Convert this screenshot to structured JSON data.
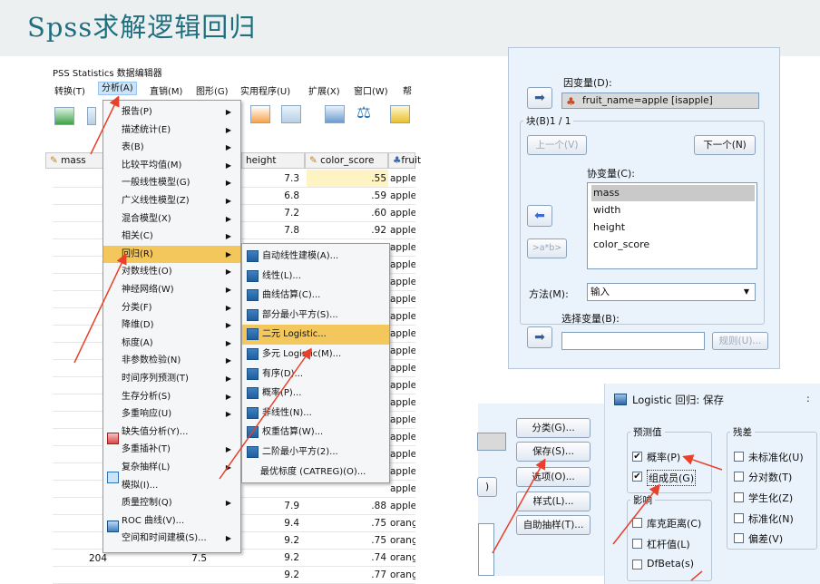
{
  "page_title": "Spss求解逻辑回归",
  "spss": {
    "window_title": "PSS Statistics 数据编辑器",
    "menubar": [
      "转换(T)",
      "分析(A)",
      "直销(M)",
      "图形(G)",
      "实用程序(U)",
      "扩展(X)",
      "窗口(W)",
      "帮"
    ],
    "columns": [
      "mass",
      "height",
      "color_score",
      "fruit"
    ],
    "analyze_menu": [
      "报告(P)",
      "描述统计(E)",
      "表(B)",
      "比较平均值(M)",
      "一般线性模型(G)",
      "广义线性模型(Z)",
      "混合模型(X)",
      "相关(C)",
      "回归(R)",
      "对数线性(O)",
      "神经网络(W)",
      "分类(F)",
      "降维(D)",
      "标度(A)",
      "非参数检验(N)",
      "时间序列预测(T)",
      "生存分析(S)",
      "多重响应(U)",
      "缺失值分析(Y)...",
      "多重插补(T)",
      "复杂抽样(L)",
      "模拟(I)...",
      "质量控制(Q)",
      "ROC 曲线(V)...",
      "空间和时间建模(S)..."
    ],
    "regression_submenu": [
      "自动线性建模(A)...",
      "线性(L)...",
      "曲线估算(C)...",
      "部分最小平方(S)...",
      "二元 Logistic...",
      "多元 Logistic(M)...",
      "有序(D)...",
      "概率(P)...",
      "非线性(N)...",
      "权重估算(W)...",
      "二阶最小平方(2)...",
      "最优标度 (CATREG)(O)..."
    ],
    "height_values": [
      "7.3",
      "6.8",
      "7.2",
      "7.8",
      "",
      "",
      "",
      "",
      "",
      "",
      "",
      "",
      "",
      "",
      "",
      "",
      "",
      "",
      "",
      "7.9",
      "9.4",
      "9.2",
      "9.2",
      "9.2"
    ],
    "color_values": [
      ".55",
      ".59",
      ".60",
      ".92",
      "",
      "",
      "",
      "",
      "",
      "",
      "",
      "",
      "",
      "",
      "",
      "",
      "",
      "",
      "",
      ".88",
      ".75",
      ".75",
      ".74",
      ".77"
    ],
    "fruit_values": [
      "apple",
      "apple",
      "apple",
      "apple",
      "apple",
      "apple",
      "apple",
      "apple",
      "apple",
      "apple",
      "apple",
      "apple",
      "apple",
      "apple",
      "apple",
      "apple",
      "apple",
      "apple",
      "apple",
      "apple",
      "orang",
      "orang",
      "orang",
      "orang"
    ],
    "row_number": "204",
    "row_value": "7.5"
  },
  "logistic_dialog": {
    "dependent_label": "因变量(D):",
    "dependent_value": "fruit_name=apple [isapple]",
    "block_label": "块(B)1 / 1",
    "prev_button": "上一个(V)",
    "next_button": "下一个(N)",
    "covariates_label": "协变量(C):",
    "covariates": [
      "mass",
      "width",
      "height",
      "color_score"
    ],
    "interaction_button": ">a*b>",
    "method_label": "方法(M):",
    "method_value": "输入",
    "select_var_label": "选择变量(B):",
    "rule_button": "规则(U)..."
  },
  "buttons_panel": {
    "buttons": [
      "分类(G)...",
      "保存(S)...",
      "选项(O)...",
      "样式(L)...",
      "自助抽样(T)..."
    ],
    "partial_button": ")"
  },
  "save_dialog": {
    "title": "Logistic 回归: 保存",
    "predicted_group": "预测值",
    "predicted_items": [
      {
        "label": "概率(P)",
        "checked": true
      },
      {
        "label": "组成员(G)",
        "checked": true
      }
    ],
    "influence_group": "影响",
    "influence_items": [
      "库克距离(C)",
      "杠杆值(L)",
      "DfBeta(s)"
    ],
    "residuals_group": "残差",
    "residual_items": [
      "未标准化(U)",
      "分对数(T)",
      "学生化(Z)",
      "标准化(N)",
      "偏差(V)"
    ]
  },
  "colors": {
    "title": "#1e6f80",
    "highlight": "#f3c75b",
    "annotation_arrow": "#e8402a"
  }
}
